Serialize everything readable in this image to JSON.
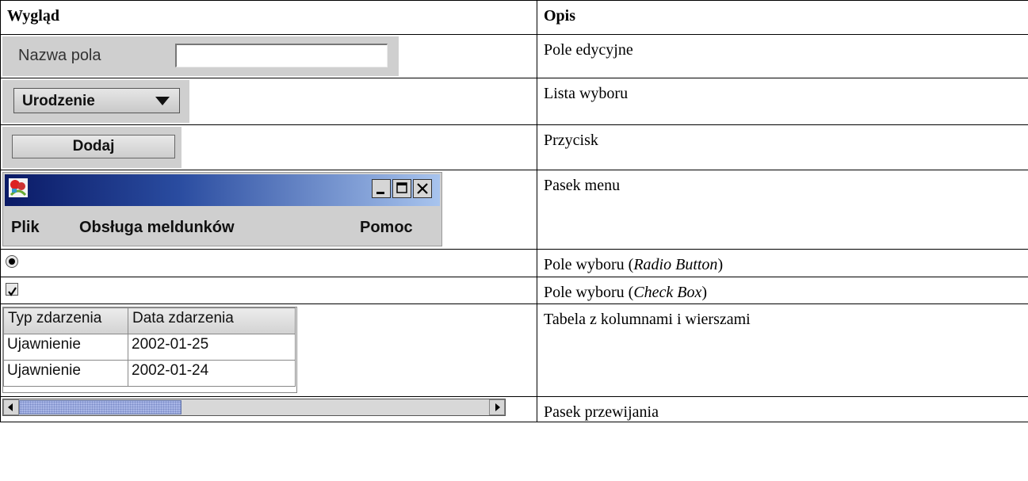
{
  "header": {
    "col1": "Wygląd",
    "col2": "Opis"
  },
  "rows": [
    {
      "desc": "Pole edycyjne",
      "label": "Nazwa pola"
    },
    {
      "desc": "Lista wyboru",
      "value": "Urodzenie"
    },
    {
      "desc": "Przycisk",
      "label": "Dodaj"
    },
    {
      "desc": "Pasek menu",
      "menu": [
        "Plik",
        "Obsługa meldunków",
        "Pomoc"
      ]
    },
    {
      "desc_prefix": "Pole wyboru (",
      "desc_em": "Radio Button",
      "desc_suffix": ")"
    },
    {
      "desc_prefix": "Pole wyboru (",
      "desc_em": "Check Box",
      "desc_suffix": ")"
    },
    {
      "desc": "Tabela z kolumnami i wierszami",
      "table": {
        "columns": [
          "Typ zdarzenia",
          "Data zdarzenia"
        ],
        "rows": [
          [
            "Ujawnienie",
            "2002-01-25"
          ],
          [
            "Ujawnienie",
            "2002-01-24"
          ]
        ]
      }
    },
    {
      "desc": "Pasek przewijania",
      "scroll_position": 0.0
    }
  ]
}
